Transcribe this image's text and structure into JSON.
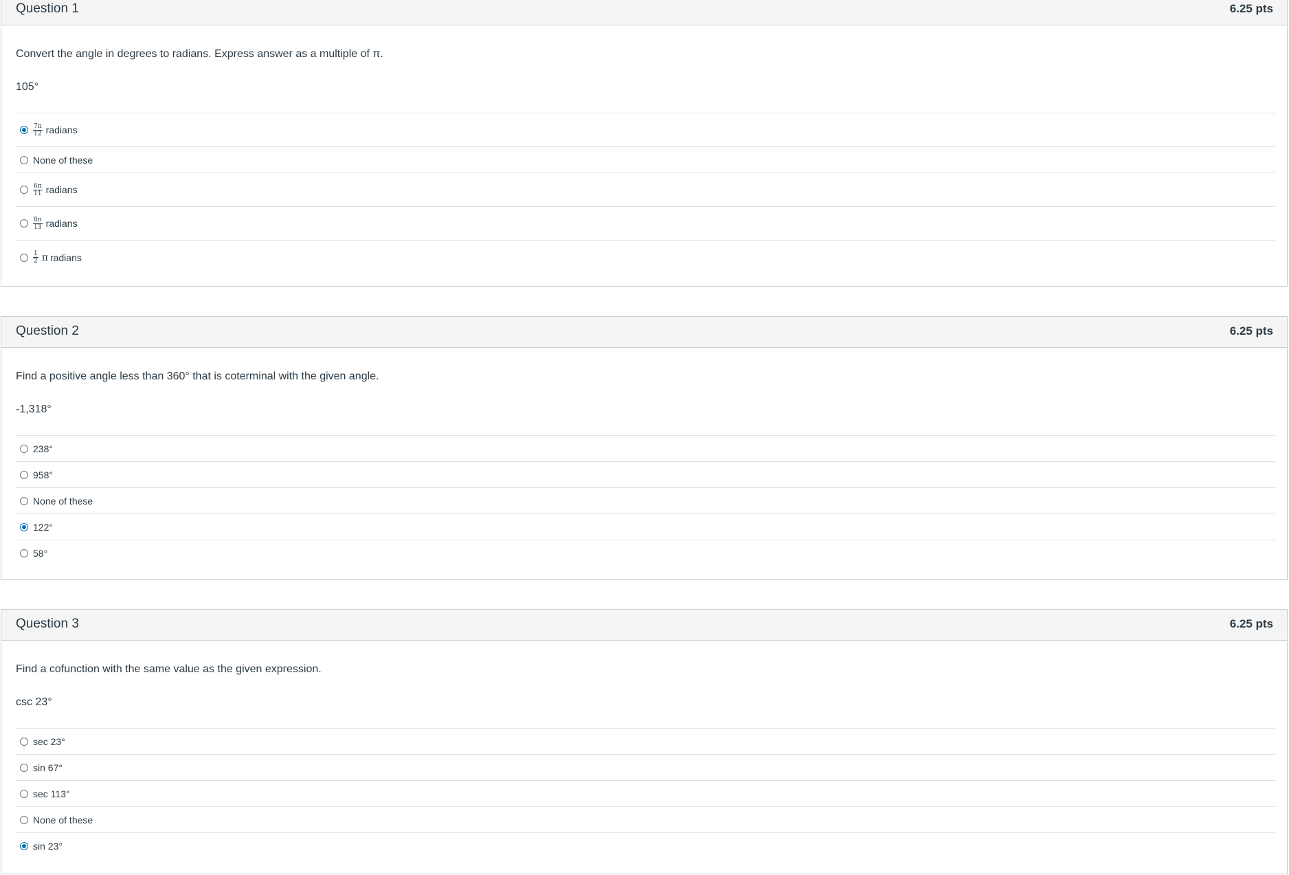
{
  "questions": [
    {
      "title": "Question 1",
      "points": "6.25 pts",
      "prompt": "Convert the angle in degrees to radians. Express answer as a multiple of π.",
      "given": "105°",
      "answers": [
        {
          "num": "7π",
          "den": "12",
          "label": "radians",
          "selected": true
        },
        {
          "label": "None of these",
          "selected": false
        },
        {
          "num": "6π",
          "den": "11",
          "label": "radians",
          "selected": false
        },
        {
          "num": "8π",
          "den": "13",
          "label": "radians",
          "selected": false
        },
        {
          "num": "1",
          "den": "2",
          "pi": "π",
          "label": "radians",
          "selected": false
        }
      ]
    },
    {
      "title": "Question 2",
      "points": "6.25 pts",
      "prompt": "Find a positive angle less than 360° that is coterminal with the given angle.",
      "given": "-1,318°",
      "answers": [
        {
          "label": "238°",
          "selected": false
        },
        {
          "label": "958°",
          "selected": false
        },
        {
          "label": "None of these",
          "selected": false
        },
        {
          "label": "122°",
          "selected": true
        },
        {
          "label": "58°",
          "selected": false
        }
      ]
    },
    {
      "title": "Question 3",
      "points": "6.25 pts",
      "prompt": "Find a cofunction with the same value as the given expression.",
      "given": "csc 23°",
      "answers": [
        {
          "label": "sec 23°",
          "selected": false
        },
        {
          "label": "sin 67°",
          "selected": false
        },
        {
          "label": "sec 113°",
          "selected": false
        },
        {
          "label": "None of these",
          "selected": false
        },
        {
          "label": "sin 23°",
          "selected": true
        }
      ]
    }
  ]
}
